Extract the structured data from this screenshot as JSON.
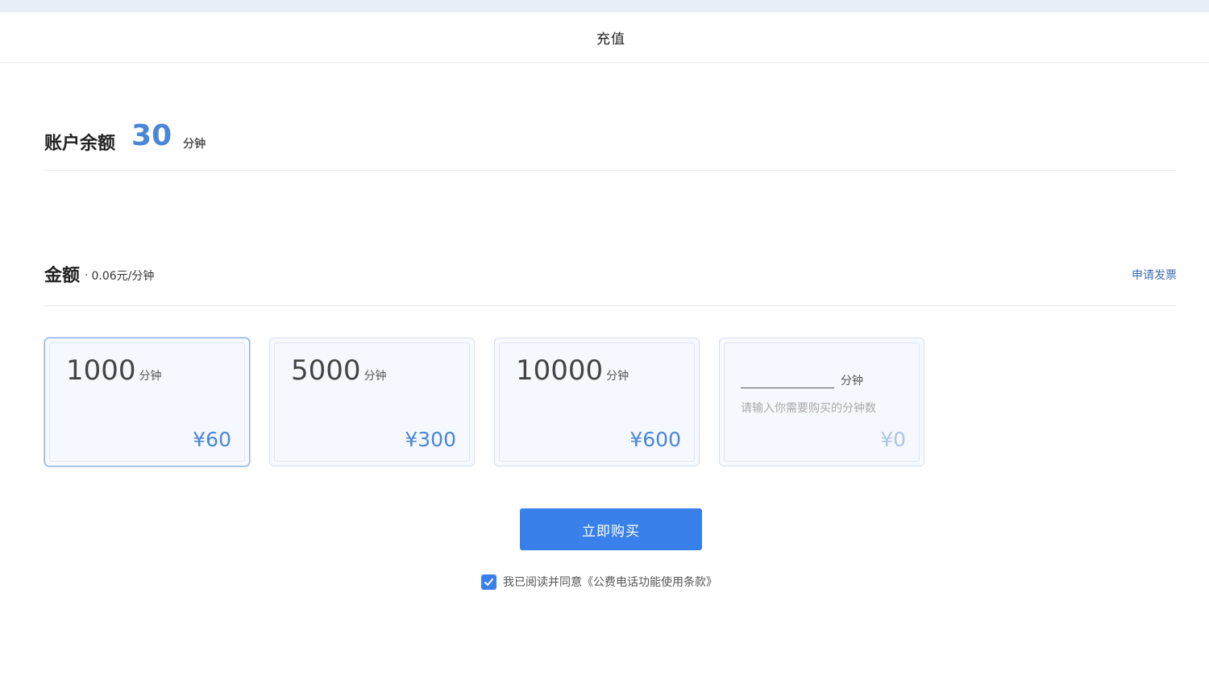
{
  "header": {
    "title": "充值"
  },
  "balance": {
    "label": "账户余额",
    "value": "30",
    "unit": "分钟"
  },
  "amount": {
    "label": "金额",
    "separator": "·",
    "rate": "0.06元/分钟",
    "invoice_link": "申请发票"
  },
  "packages": [
    {
      "minutes": "1000",
      "unit": "分钟",
      "price": "¥60",
      "selected": true
    },
    {
      "minutes": "5000",
      "unit": "分钟",
      "price": "¥300",
      "selected": false
    },
    {
      "minutes": "10000",
      "unit": "分钟",
      "price": "¥600",
      "selected": false
    }
  ],
  "custom_package": {
    "value": "",
    "unit": "分钟",
    "hint": "请输入你需要购买的分钟数",
    "price": "¥0"
  },
  "buy_button": {
    "label": "立即购买"
  },
  "agreement": {
    "text": "我已阅读并同意《公费电话功能使用条款》",
    "checked": true
  },
  "colors": {
    "accent": "#3a80ea",
    "value_blue": "#4a86d8",
    "link": "#3a6bb5"
  }
}
